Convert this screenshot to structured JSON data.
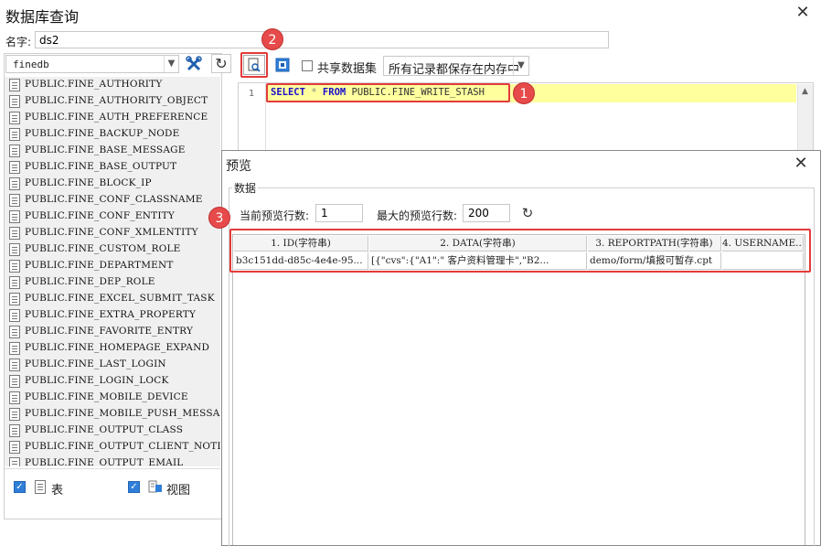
{
  "window": {
    "title": "数据库查询",
    "close_glyph": "✕"
  },
  "name_field": {
    "label": "名字:",
    "value": "ds2"
  },
  "left": {
    "database": "finedb",
    "tables": [
      "PUBLIC.FINE_AUTHORITY",
      "PUBLIC.FINE_AUTHORITY_OBJECT",
      "PUBLIC.FINE_AUTH_PREFERENCE",
      "PUBLIC.FINE_BACKUP_NODE",
      "PUBLIC.FINE_BASE_MESSAGE",
      "PUBLIC.FINE_BASE_OUTPUT",
      "PUBLIC.FINE_BLOCK_IP",
      "PUBLIC.FINE_CONF_CLASSNAME",
      "PUBLIC.FINE_CONF_ENTITY",
      "PUBLIC.FINE_CONF_XMLENTITY",
      "PUBLIC.FINE_CUSTOM_ROLE",
      "PUBLIC.FINE_DEPARTMENT",
      "PUBLIC.FINE_DEP_ROLE",
      "PUBLIC.FINE_EXCEL_SUBMIT_TASK",
      "PUBLIC.FINE_EXTRA_PROPERTY",
      "PUBLIC.FINE_FAVORITE_ENTRY",
      "PUBLIC.FINE_HOMEPAGE_EXPAND",
      "PUBLIC.FINE_LAST_LOGIN",
      "PUBLIC.FINE_LOGIN_LOCK",
      "PUBLIC.FINE_MOBILE_DEVICE",
      "PUBLIC.FINE_MOBILE_PUSH_MESSAGE",
      "PUBLIC.FINE_OUTPUT_CLASS",
      "PUBLIC.FINE_OUTPUT_CLIENT_NOTICE",
      "PUBLIC.FINE_OUTPUT_EMAIL"
    ],
    "filter_table_label": "表",
    "filter_view_label": "视图"
  },
  "toolbar": {
    "share_label": "共享数据集",
    "memory_option": "所有记录都保存在内存中"
  },
  "editor": {
    "line_number": "1",
    "sql_keyword_select": "SELECT",
    "sql_star": "*",
    "sql_keyword_from": "FROM",
    "sql_table": "PUBLIC.FINE_WRITE_STASH"
  },
  "badges": {
    "one": "1",
    "two": "2",
    "three": "3"
  },
  "preview": {
    "title": "预览",
    "group_label": "数据",
    "current_rows_label": "当前预览行数:",
    "current_rows_value": "1",
    "max_rows_label": "最大的预览行数:",
    "max_rows_value": "200",
    "columns": [
      "1. ID(字符串)",
      "2. DATA(字符串)",
      "3. REPORTPATH(字符串)",
      "4. USERNAME..."
    ],
    "row": [
      "b3c151dd-d85c-4e4e-95...",
      "[{\"cvs\":{\"A1\":\"  客户资料管理卡\",\"B2...",
      "demo/form/填报可暂存.cpt",
      ""
    ]
  },
  "colors": {
    "highlight": "#e33b3b",
    "sql_keyword": "#1a0dcb",
    "sql_line_bg": "#ffff9e",
    "checkbox": "#2f7fd8"
  }
}
